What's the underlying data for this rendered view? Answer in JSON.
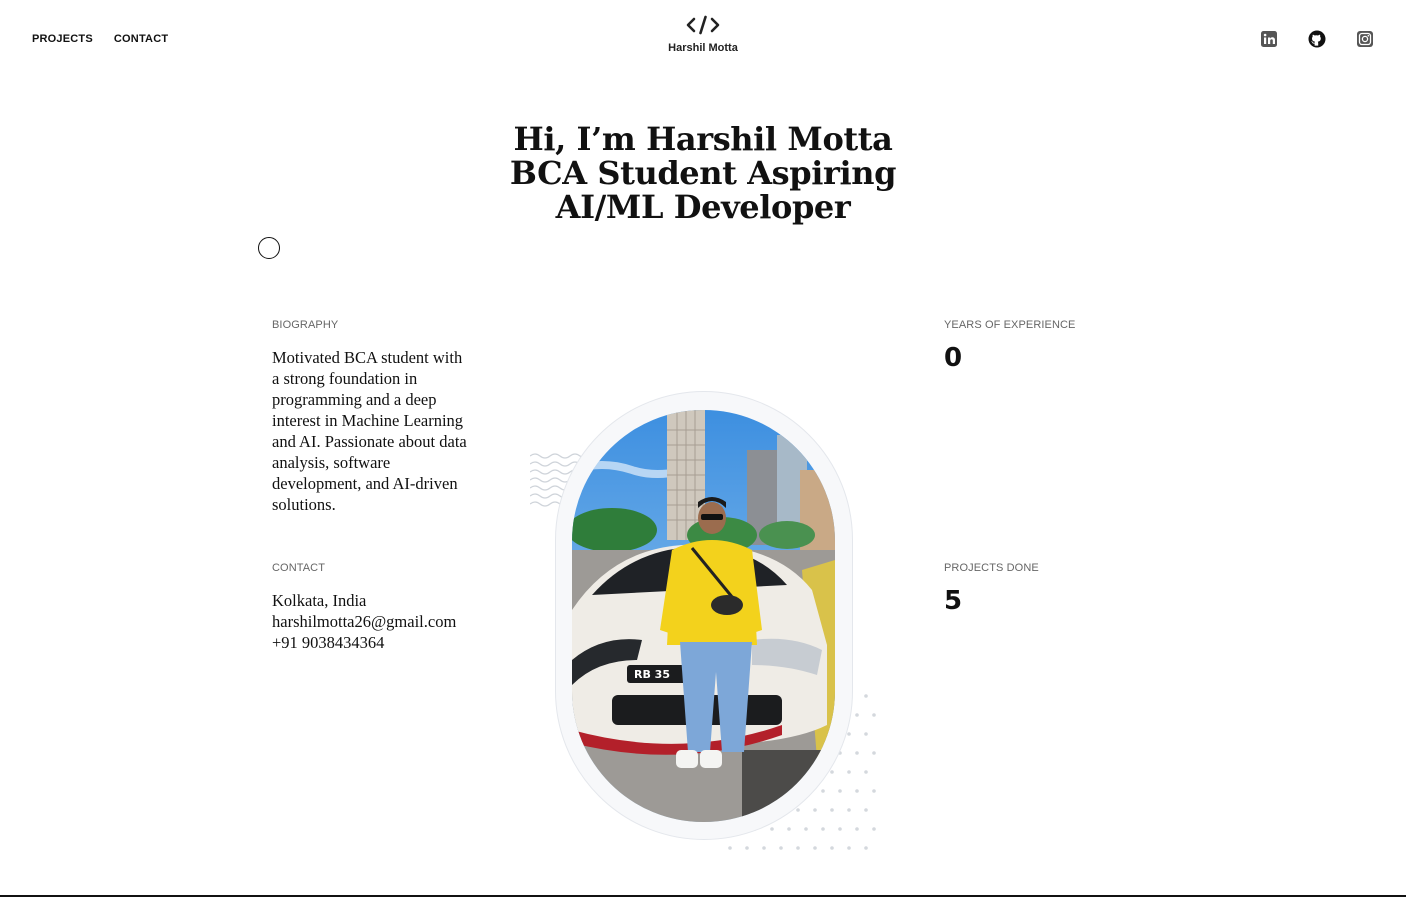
{
  "nav": {
    "projects_label": "PROJECTS",
    "contact_label": "CONTACT"
  },
  "brand": {
    "icon": "code-icon",
    "name": "Harshil Motta"
  },
  "social": {
    "linkedin_icon": "linkedin-icon",
    "github_icon": "github-icon",
    "instagram_icon": "instagram-icon"
  },
  "hero": {
    "line1": "Hi, I’m Harshil Motta",
    "line2": "BCA Student Aspiring",
    "line3": "AI/ML Developer"
  },
  "biography": {
    "label": "BIOGRAPHY",
    "text": "Motivated BCA student with a strong foundation in programming and a deep interest in Machine Learning and AI. Passionate about data analysis, software development, and AI-driven solutions."
  },
  "contact": {
    "label": "CONTACT",
    "location": "Kolkata, India",
    "email": "harshilmotta26@gmail.com",
    "phone": "+91 9038434364"
  },
  "stats": {
    "experience_label": "YEARS OF EXPERIENCE",
    "experience_value": "0",
    "projects_label": "PROJECTS DONE",
    "projects_value": "5"
  },
  "colors": {
    "text": "#111111",
    "muted": "#666666",
    "portrait_border": "#e4e7ec",
    "sky": "#5fa8e8",
    "jacket": "#f3d21c"
  }
}
